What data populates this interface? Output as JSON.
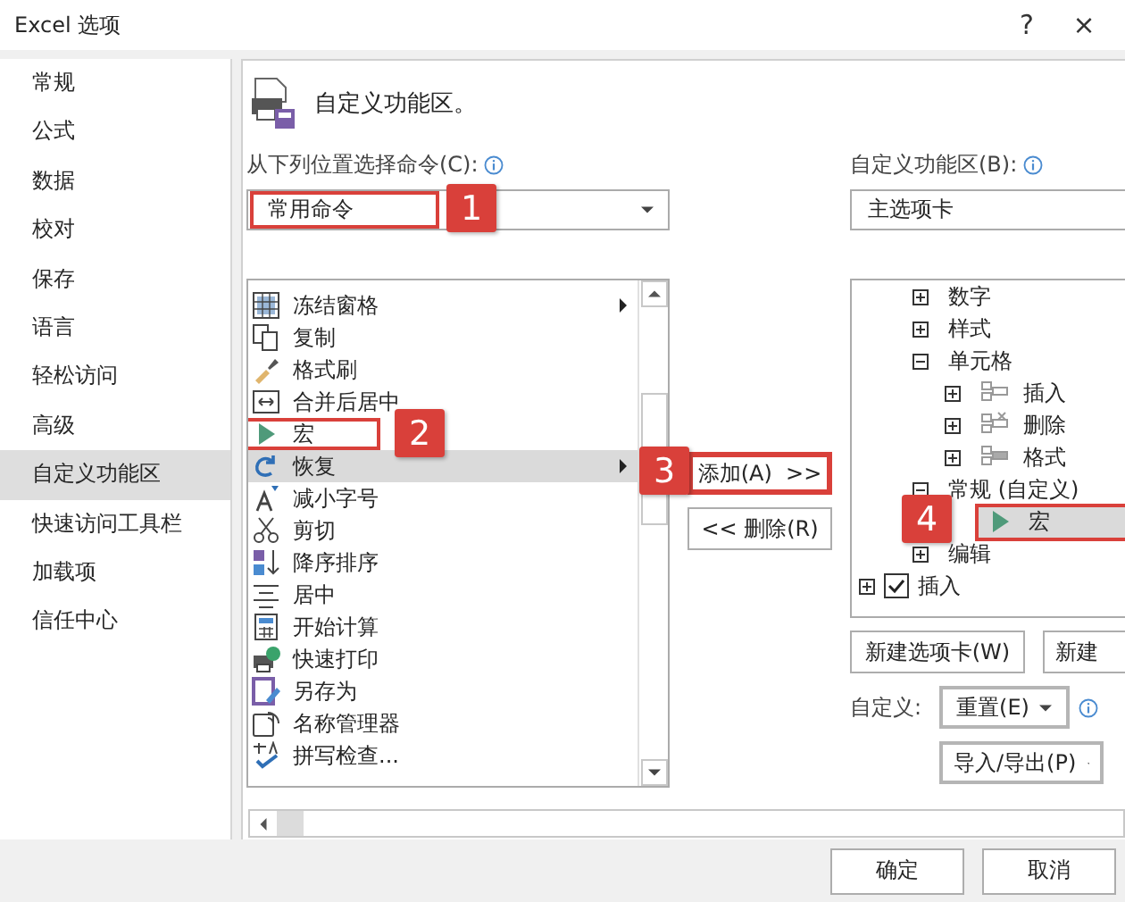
{
  "window": {
    "title": "Excel 选项",
    "help": "?",
    "close": "×"
  },
  "sidebar": {
    "items": [
      {
        "label": "常规",
        "selected": false
      },
      {
        "label": "公式",
        "selected": false
      },
      {
        "label": "数据",
        "selected": false
      },
      {
        "label": "校对",
        "selected": false
      },
      {
        "label": "保存",
        "selected": false
      },
      {
        "label": "语言",
        "selected": false
      },
      {
        "label": "轻松访问",
        "selected": false
      },
      {
        "label": "高级",
        "selected": false
      },
      {
        "label": "自定义功能区",
        "selected": true
      },
      {
        "label": "快速访问工具栏",
        "selected": false
      },
      {
        "label": "加载项",
        "selected": false
      },
      {
        "label": "信任中心",
        "selected": false
      }
    ]
  },
  "header": {
    "title": "自定义功能区。"
  },
  "commands": {
    "label": "从下列位置选择命令(C):",
    "source": {
      "value": "常用命令",
      "callout": "1"
    },
    "items": [
      {
        "label": "冻结窗格",
        "kind": "freeze",
        "submenu": true,
        "selected": false
      },
      {
        "label": "复制",
        "kind": "copy",
        "submenu": false,
        "selected": false
      },
      {
        "label": "格式刷",
        "kind": "brush",
        "submenu": false,
        "selected": false
      },
      {
        "label": "合并后居中",
        "kind": "merge",
        "submenu": false,
        "selected": false
      },
      {
        "label": "宏",
        "kind": "macro",
        "submenu": false,
        "selected": false,
        "callout": "2"
      },
      {
        "label": "恢复",
        "kind": "redo",
        "submenu": true,
        "selected": true
      },
      {
        "label": "减小字号",
        "kind": "fontdown",
        "submenu": false,
        "selected": false
      },
      {
        "label": "剪切",
        "kind": "cut",
        "submenu": false,
        "selected": false
      },
      {
        "label": "降序排序",
        "kind": "sort",
        "submenu": false,
        "selected": false
      },
      {
        "label": "居中",
        "kind": "center",
        "submenu": false,
        "selected": false
      },
      {
        "label": "开始计算",
        "kind": "calc",
        "submenu": false,
        "selected": false
      },
      {
        "label": "快速打印",
        "kind": "print",
        "submenu": false,
        "selected": false
      },
      {
        "label": "另存为",
        "kind": "saveas",
        "submenu": false,
        "selected": false
      },
      {
        "label": "名称管理器",
        "kind": "names",
        "submenu": false,
        "selected": false
      },
      {
        "label": "拼写检查...",
        "kind": "spell",
        "submenu": false,
        "selected": false
      }
    ]
  },
  "add_button": {
    "label": "添加(A)  >>",
    "callout": "3"
  },
  "remove_button": {
    "label": "<< 删除(R)"
  },
  "ribbon": {
    "label": "自定义功能区(B):",
    "value": "主选项卡"
  },
  "tree": {
    "groups": [
      {
        "label": "数字",
        "expanded": false,
        "selected": false
      },
      {
        "label": "样式",
        "expanded": false,
        "selected": false
      },
      {
        "label": "单元格",
        "expanded": true,
        "selected": false,
        "children": [
          {
            "label": "插入",
            "kind": "insert",
            "expanded": false,
            "selected": false
          },
          {
            "label": "删除",
            "kind": "delete",
            "expanded": false,
            "selected": false
          },
          {
            "label": "格式",
            "kind": "format",
            "expanded": false,
            "selected": false
          }
        ]
      },
      {
        "label": "常规 (自定义)",
        "expanded": true,
        "selected": false,
        "children": [
          {
            "label": "宏",
            "kind": "macro",
            "selected": true,
            "callout": "4"
          }
        ]
      },
      {
        "label": "编辑",
        "expanded": false,
        "selected": false
      }
    ],
    "tabs": [
      {
        "label": "插入",
        "checked": true,
        "expanded": false
      }
    ]
  },
  "new_tab_button": "新建选项卡(W)",
  "new_group_button": "新建",
  "customize_label": "自定义:",
  "reset_button": "重置(E)",
  "import_export_button": "导入/导出(P)",
  "footer": {
    "ok": "确定",
    "cancel": "取消"
  }
}
